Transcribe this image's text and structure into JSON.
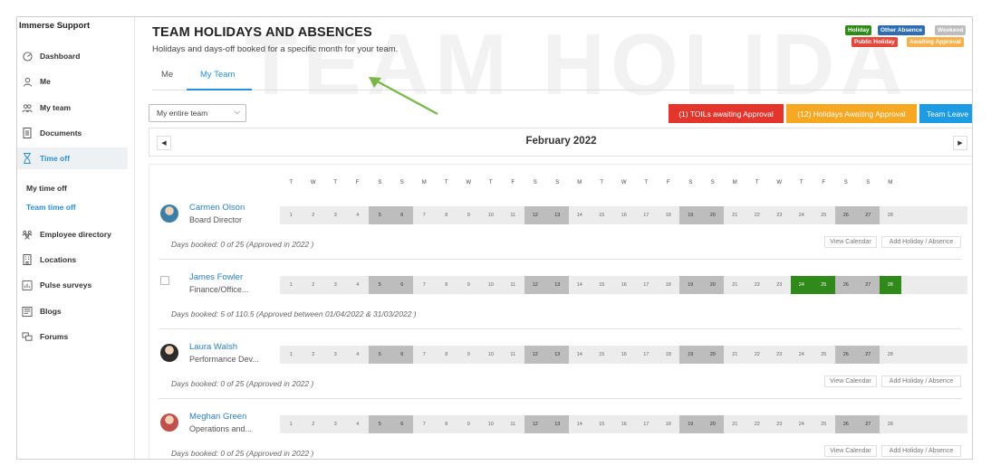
{
  "app": {
    "brand": "Immerse Support"
  },
  "sidebar": {
    "items": [
      {
        "label": "Dashboard",
        "icon": "dashboard-icon"
      },
      {
        "label": "Me",
        "icon": "user-icon"
      },
      {
        "label": "My team",
        "icon": "team-icon"
      },
      {
        "label": "Documents",
        "icon": "document-icon"
      },
      {
        "label": "Time off",
        "icon": "hourglass-icon",
        "active": true
      },
      {
        "label": "Employee directory",
        "icon": "directory-icon"
      },
      {
        "label": "Locations",
        "icon": "building-icon"
      },
      {
        "label": "Pulse surveys",
        "icon": "chart-icon"
      },
      {
        "label": "Blogs",
        "icon": "blog-icon"
      },
      {
        "label": "Forums",
        "icon": "forum-icon"
      }
    ],
    "sub_items": [
      {
        "label": "My time off"
      },
      {
        "label": "Team time off",
        "active": true
      }
    ]
  },
  "header": {
    "watermark": "TEAM HOLIDA",
    "title": "TEAM HOLIDAYS AND ABSENCES",
    "subtitle": "Holidays and days-off booked for a specific month for your team."
  },
  "legend": {
    "holiday": "Holiday",
    "other_absence": "Other Absence",
    "weekend": "Weekend",
    "public_holiday": "Public Holiday",
    "awaiting_approval": "Awaiting Approval",
    "colors": {
      "holiday": "#2f8a1a",
      "other_absence": "#2f6db3",
      "weekend": "#bdbdbd",
      "public_holiday": "#e4473b",
      "awaiting_approval": "#f8b04a"
    }
  },
  "tabs": [
    {
      "label": "Me"
    },
    {
      "label": "My Team",
      "active": true
    }
  ],
  "filter": {
    "selected": "My entire team"
  },
  "actions": {
    "toil": "(1) TOILs awaiting Approval",
    "holidays": "(12) Holidays Awaiting Approval",
    "team_leave": "Team Leave",
    "colors": {
      "toil": "#e4352d",
      "holidays": "#f7a823",
      "team_leave": "#1d9be3"
    }
  },
  "calendar": {
    "month": "February 2022",
    "weekdays": [
      "T",
      "W",
      "T",
      "F",
      "S",
      "S",
      "M",
      "T",
      "W",
      "T",
      "F",
      "S",
      "S",
      "M",
      "T",
      "W",
      "T",
      "F",
      "S",
      "S",
      "M",
      "T",
      "W",
      "T",
      "F",
      "S",
      "S",
      "M"
    ],
    "days": [
      "1",
      "2",
      "3",
      "4",
      "5",
      "6",
      "7",
      "8",
      "9",
      "10",
      "11",
      "12",
      "13",
      "14",
      "15",
      "16",
      "17",
      "18",
      "19",
      "20",
      "21",
      "22",
      "23",
      "24",
      "25",
      "26",
      "27",
      "28"
    ],
    "weekend_days": [
      "5",
      "6",
      "12",
      "13",
      "19",
      "20",
      "26",
      "27"
    ]
  },
  "employees": [
    {
      "name": "Carmen Olson",
      "role": "Board Director",
      "days_booked": "Days booked: 0 of 25 (Approved in 2022 )",
      "holiday_days": [],
      "show_buttons": true
    },
    {
      "name": "James Fowler",
      "role": "Finance/Office...",
      "days_booked": "Days booked: 5 of 110.5 (Approved between 01/04/2022 & 31/03/2022 )",
      "holiday_days": [
        "24",
        "25",
        "28"
      ],
      "show_buttons": false
    },
    {
      "name": "Laura Walsh",
      "role": "Performance Dev...",
      "days_booked": "Days booked: 0 of 25 (Approved in 2022 )",
      "holiday_days": [],
      "show_buttons": true
    },
    {
      "name": "Meghan Green",
      "role": "Operations and...",
      "days_booked": "Days booked: 0 of 25 (Approved in 2022 )",
      "holiday_days": [],
      "show_buttons": true
    }
  ],
  "row_buttons": {
    "view_calendar": "View Calendar",
    "add_holiday": "Add Holiday / Absence"
  }
}
